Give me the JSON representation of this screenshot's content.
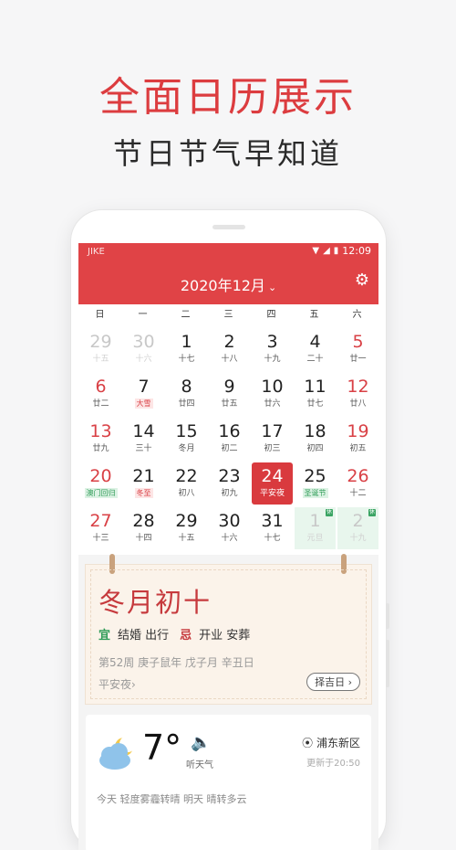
{
  "promo": {
    "title": "全面日历展示",
    "subtitle": "节日节气早知道"
  },
  "status": {
    "carrier": "JIKE",
    "time": "12:09"
  },
  "calendar": {
    "month_title": "2020年12月",
    "weekdays": [
      "日",
      "一",
      "二",
      "三",
      "四",
      "五",
      "六"
    ],
    "weeks": [
      [
        {
          "d": "29",
          "l": "十五",
          "o": true
        },
        {
          "d": "30",
          "l": "十六",
          "o": true
        },
        {
          "d": "1",
          "l": "十七"
        },
        {
          "d": "2",
          "l": "十八"
        },
        {
          "d": "3",
          "l": "十九"
        },
        {
          "d": "4",
          "l": "二十"
        },
        {
          "d": "5",
          "l": "廿一"
        }
      ],
      [
        {
          "d": "6",
          "l": "廿二"
        },
        {
          "d": "7",
          "l": "大雪",
          "t": "red"
        },
        {
          "d": "8",
          "l": "廿四"
        },
        {
          "d": "9",
          "l": "廿五"
        },
        {
          "d": "10",
          "l": "廿六"
        },
        {
          "d": "11",
          "l": "廿七"
        },
        {
          "d": "12",
          "l": "廿八"
        }
      ],
      [
        {
          "d": "13",
          "l": "廿九"
        },
        {
          "d": "14",
          "l": "三十"
        },
        {
          "d": "15",
          "l": "冬月"
        },
        {
          "d": "16",
          "l": "初二"
        },
        {
          "d": "17",
          "l": "初三"
        },
        {
          "d": "18",
          "l": "初四"
        },
        {
          "d": "19",
          "l": "初五"
        }
      ],
      [
        {
          "d": "20",
          "l": "澳门回归",
          "t": "green"
        },
        {
          "d": "21",
          "l": "冬至",
          "t": "red"
        },
        {
          "d": "22",
          "l": "初八"
        },
        {
          "d": "23",
          "l": "初九"
        },
        {
          "d": "24",
          "l": "平安夜",
          "today": true
        },
        {
          "d": "25",
          "l": "圣诞节",
          "t": "green"
        },
        {
          "d": "26",
          "l": "十二"
        }
      ],
      [
        {
          "d": "27",
          "l": "十三"
        },
        {
          "d": "28",
          "l": "十四"
        },
        {
          "d": "29",
          "l": "十五"
        },
        {
          "d": "30",
          "l": "十六"
        },
        {
          "d": "31",
          "l": "十七"
        },
        {
          "d": "1",
          "l": "元旦",
          "o": true,
          "g": true,
          "b": "休"
        },
        {
          "d": "2",
          "l": "十九",
          "o": true,
          "g": true,
          "b": "休"
        }
      ]
    ]
  },
  "almanac": {
    "lunar_date": "冬月初十",
    "yi_label": "宜",
    "yi": "结婚 出行",
    "ji_label": "忌",
    "ji": "开业 安葬",
    "ganzhi": "第52周 庚子鼠年 戊子月 辛丑日",
    "festival": "平安夜",
    "festival_arrow": "›",
    "pick_button": "择吉日"
  },
  "weather": {
    "temperature": "7°",
    "listen": "听天气",
    "location": "浦东新区",
    "updated": "更新于20:50",
    "forecast_partial": "今天 轻度雾霾转晴 明天 晴转多云"
  },
  "icons": {
    "wifi": "wifi-icon",
    "signal": "signal-icon",
    "battery": "battery-icon",
    "settings": "gear-icon",
    "speaker": "speaker-icon",
    "location": "location-pin-icon",
    "weather": "partly-cloudy-night-icon"
  },
  "colors": {
    "accent": "#dc3c3f",
    "holiday_green": "#2f9c57"
  }
}
